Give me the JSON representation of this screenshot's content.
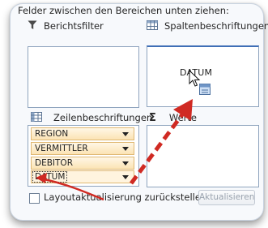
{
  "instruction": "Felder zwischen den Bereichen unten ziehen:",
  "areas": {
    "report_filter": {
      "label": "Berichtsfilter",
      "icon": "filter-icon"
    },
    "column_labels": {
      "label": "Spaltenbeschriftungen",
      "icon": "column-grid-icon",
      "dragged_field": "DATUM"
    },
    "row_labels": {
      "label": "Zeilenbeschriftungen",
      "icon": "row-grid-icon",
      "fields": [
        "REGION",
        "VERMITTLER",
        "DEBITOR",
        "DATUM"
      ]
    },
    "values": {
      "label": "Werte",
      "icon": "sigma-icon"
    }
  },
  "defer_update": {
    "label": "Layoutaktualisierung zurückstellen",
    "checked": false
  },
  "update_button": {
    "label": "Aktualisieren",
    "enabled": false
  },
  "colors": {
    "arrow": "#d02a23",
    "field_fill": "#fbe3b4",
    "field_border": "#e0b873",
    "selected_border": "#3f6fb6"
  }
}
